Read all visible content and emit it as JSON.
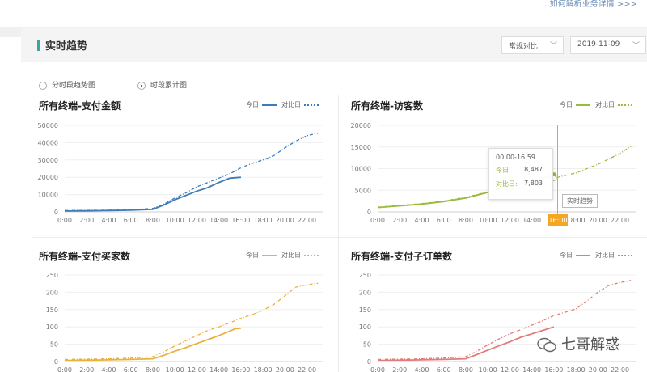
{
  "top": {
    "link_text": "...如何解析业务详情 >>>"
  },
  "section": {
    "title": "实时趋势",
    "select_compare": "常规对比",
    "select_date": "2019-11-09"
  },
  "modes": [
    {
      "label": "分时段趋势图",
      "selected": false
    },
    {
      "label": "时段累计图",
      "selected": true
    }
  ],
  "legend": {
    "today": "今日",
    "compare": "对比日"
  },
  "tooltip": {
    "range": "00:00-16:59",
    "today_label": "今日:",
    "today_value": "8,487",
    "compare_label": "对比日:",
    "compare_value": "7,803",
    "hover_tip": "实时趋势",
    "hover_time": "16:00"
  },
  "watermark": "七哥解惑",
  "chart_data": [
    {
      "type": "line",
      "title": "所有终端-支付金额",
      "color": "#3e7cb8",
      "ylim": [
        0,
        50000
      ],
      "yticks": [
        "0",
        "10000",
        "20000",
        "30000",
        "40000",
        "50000"
      ],
      "xticks": [
        "0:00",
        "2:00",
        "4:00",
        "6:00",
        "8:00",
        "10:00",
        "12:00",
        "14:00",
        "16:00",
        "18:00",
        "20:00",
        "22:00"
      ],
      "series": [
        {
          "name": "今日",
          "x": [
            0,
            2,
            4,
            6,
            8,
            9,
            10,
            11,
            12,
            13,
            14,
            15,
            16
          ],
          "y": [
            500,
            600,
            800,
            1000,
            1500,
            4000,
            7000,
            9500,
            12000,
            14000,
            17000,
            19500,
            20000
          ]
        },
        {
          "name": "对比日",
          "x": [
            0,
            2,
            4,
            6,
            8,
            9,
            10,
            11,
            12,
            13,
            14,
            15,
            16,
            17,
            18,
            19,
            20,
            21,
            22,
            23
          ],
          "y": [
            800,
            900,
            1000,
            1200,
            2000,
            4500,
            8000,
            11000,
            14500,
            17000,
            19500,
            22000,
            25500,
            28000,
            30000,
            32500,
            37000,
            41000,
            44000,
            45500
          ]
        }
      ]
    },
    {
      "type": "line",
      "title": "所有终端-访客数",
      "color": "#9aba3a",
      "ylim": [
        0,
        20000
      ],
      "yticks": [
        "0",
        "5000",
        "10000",
        "15000",
        "20000"
      ],
      "xticks": [
        "0:00",
        "2:00",
        "4:00",
        "6:00",
        "8:00",
        "10:00",
        "12:00",
        "14:00",
        "16:00",
        "18:00",
        "20:00",
        "22:00"
      ],
      "series": [
        {
          "name": "今日",
          "x": [
            0,
            2,
            4,
            6,
            8,
            10,
            12,
            14,
            16
          ],
          "y": [
            1000,
            1400,
            1800,
            2400,
            3200,
            4500,
            6000,
            7200,
            8487
          ]
        },
        {
          "name": "对比日",
          "x": [
            0,
            2,
            4,
            6,
            8,
            10,
            12,
            14,
            16,
            18,
            20,
            22,
            23
          ],
          "y": [
            1100,
            1500,
            1900,
            2500,
            3400,
            4600,
            5900,
            7000,
            7803,
            9000,
            11000,
            13500,
            15200
          ]
        }
      ]
    },
    {
      "type": "line",
      "title": "所有终端-支付买家数",
      "color": "#e8b23c",
      "ylim": [
        0,
        250
      ],
      "yticks": [
        "0",
        "50",
        "100",
        "150",
        "200",
        "250"
      ],
      "xticks": [
        "0:00",
        "2:00",
        "4:00",
        "6:00",
        "8:00",
        "10:00",
        "12:00",
        "14:00",
        "16:00",
        "18:00",
        "20:00",
        "22:00"
      ],
      "series": [
        {
          "name": "今日",
          "x": [
            0,
            2,
            4,
            6,
            8,
            9,
            10,
            11,
            12,
            13,
            14,
            15,
            15.5,
            16
          ],
          "y": [
            3,
            4,
            5,
            6,
            8,
            18,
            30,
            40,
            52,
            63,
            75,
            88,
            95,
            96
          ]
        },
        {
          "name": "对比日",
          "x": [
            0,
            2,
            4,
            6,
            8,
            9,
            10,
            11,
            12,
            13,
            14,
            15,
            16,
            17,
            18,
            19,
            20,
            21,
            22,
            23
          ],
          "y": [
            6,
            7,
            8,
            10,
            14,
            28,
            45,
            60,
            75,
            90,
            100,
            112,
            125,
            135,
            148,
            165,
            190,
            215,
            222,
            226
          ]
        }
      ]
    },
    {
      "type": "line",
      "title": "所有终端-支付子订单数",
      "color": "#e07c7c",
      "ylim": [
        0,
        250
      ],
      "yticks": [
        "0",
        "50",
        "100",
        "150",
        "200",
        "250"
      ],
      "xticks": [
        "0:00",
        "2:00",
        "4:00",
        "6:00",
        "8:00",
        "10:00",
        "12:00",
        "14:00",
        "16:00",
        "18:00",
        "20:00",
        "22:00"
      ],
      "series": [
        {
          "name": "今日",
          "x": [
            0,
            2,
            4,
            6,
            8,
            9,
            10,
            11,
            12,
            13,
            14,
            15,
            16
          ],
          "y": [
            3,
            4,
            5,
            6,
            8,
            20,
            33,
            45,
            57,
            70,
            80,
            90,
            100
          ]
        },
        {
          "name": "对比日",
          "x": [
            0,
            2,
            4,
            6,
            8,
            9,
            10,
            11,
            12,
            13,
            14,
            15,
            16,
            17,
            18,
            19,
            20,
            21,
            22,
            23
          ],
          "y": [
            6,
            7,
            8,
            10,
            14,
            30,
            48,
            65,
            80,
            92,
            105,
            118,
            133,
            142,
            152,
            175,
            200,
            220,
            228,
            234
          ]
        }
      ]
    }
  ]
}
